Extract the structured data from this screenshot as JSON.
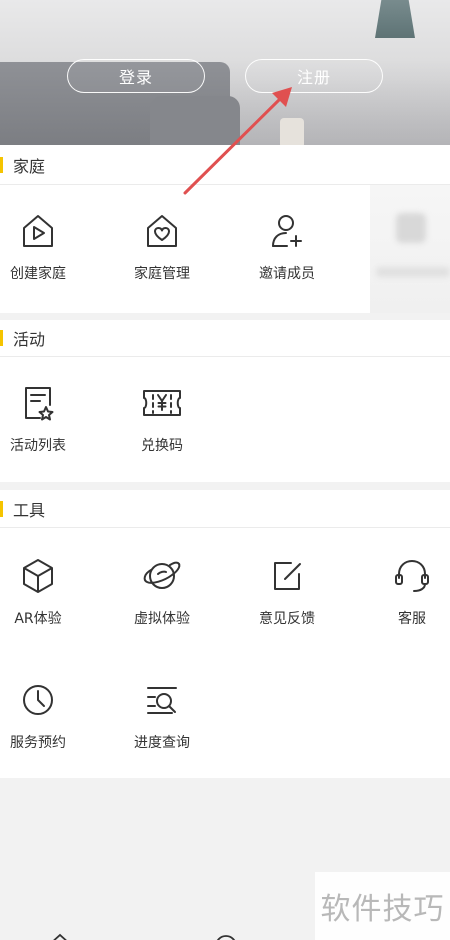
{
  "header": {
    "login_label": "登录",
    "register_label": "注册"
  },
  "sections": {
    "family": {
      "title": "家庭",
      "items": [
        {
          "label": "创建家庭",
          "icon": "house-play-icon"
        },
        {
          "label": "家庭管理",
          "icon": "house-heart-icon"
        },
        {
          "label": "邀请成员",
          "icon": "user-add-icon"
        }
      ]
    },
    "activity": {
      "title": "活动",
      "items": [
        {
          "label": "活动列表",
          "icon": "list-star-icon"
        },
        {
          "label": "兑换码",
          "icon": "ticket-yen-icon"
        }
      ]
    },
    "tools": {
      "title": "工具",
      "items": [
        {
          "label": "AR体验",
          "icon": "cube-icon"
        },
        {
          "label": "虚拟体验",
          "icon": "planet-icon"
        },
        {
          "label": "意见反馈",
          "icon": "edit-note-icon"
        },
        {
          "label": "客服",
          "icon": "headset-icon"
        },
        {
          "label": "服务预约",
          "icon": "clock-icon"
        },
        {
          "label": "进度查询",
          "icon": "list-search-icon"
        }
      ]
    }
  },
  "watermark": "软件技巧",
  "colors": {
    "accent": "#f5c400",
    "arrow": "#e05050",
    "icon_stroke": "#333333"
  }
}
